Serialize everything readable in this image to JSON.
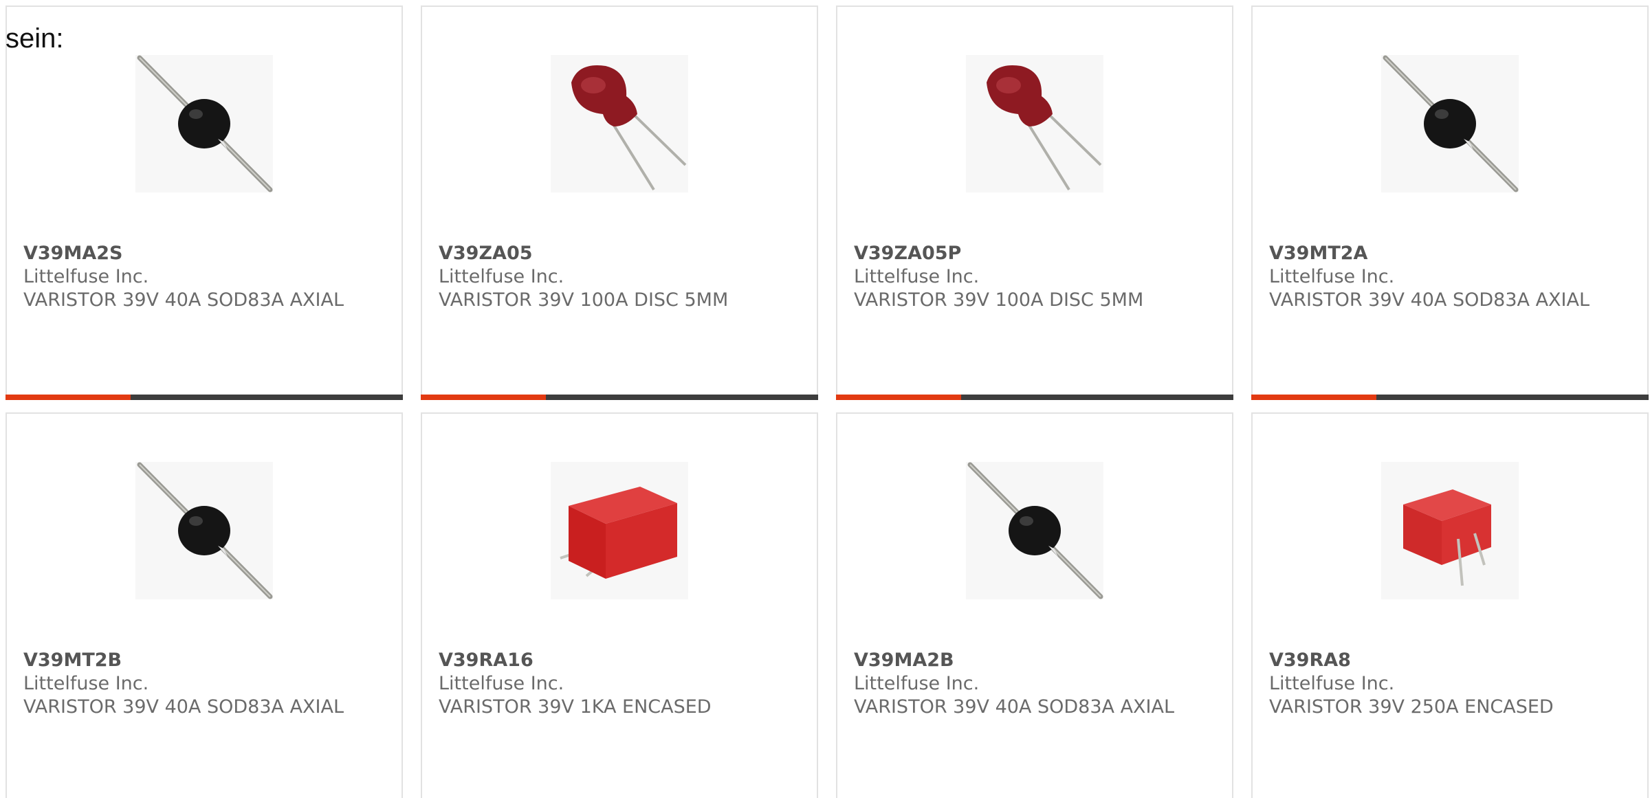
{
  "intro_text": "sein:",
  "colors": {
    "accent": "#e23a12",
    "bar": "#3d3d3d",
    "border": "#e2e2e2",
    "text": "#6a6a6a"
  },
  "products": [
    {
      "part": "V39MA2S",
      "manufacturer": "Littelfuse Inc.",
      "description": "VARISTOR 39V 40A SOD83A AXIAL",
      "image_icon": "axial-varistor-image"
    },
    {
      "part": "V39ZA05",
      "manufacturer": "Littelfuse Inc.",
      "description": "VARISTOR 39V 100A DISC 5MM",
      "image_icon": "disc-varistor-image"
    },
    {
      "part": "V39ZA05P",
      "manufacturer": "Littelfuse Inc.",
      "description": "VARISTOR 39V 100A DISC 5MM",
      "image_icon": "disc-varistor-image"
    },
    {
      "part": "V39MT2A",
      "manufacturer": "Littelfuse Inc.",
      "description": "VARISTOR 39V 40A SOD83A AXIAL",
      "image_icon": "axial-varistor-image"
    },
    {
      "part": "V39MT2B",
      "manufacturer": "Littelfuse Inc.",
      "description": "VARISTOR 39V 40A SOD83A AXIAL",
      "image_icon": "axial-varistor-image"
    },
    {
      "part": "V39RA16",
      "manufacturer": "Littelfuse Inc.",
      "description": "VARISTOR 39V 1KA ENCASED",
      "image_icon": "encased-varistor-image"
    },
    {
      "part": "V39MA2B",
      "manufacturer": "Littelfuse Inc.",
      "description": "VARISTOR 39V 40A SOD83A AXIAL",
      "image_icon": "axial-varistor-image"
    },
    {
      "part": "V39RA8",
      "manufacturer": "Littelfuse Inc.",
      "description": "VARISTOR 39V 250A ENCASED",
      "image_icon": "encased-small-varistor-image"
    }
  ]
}
